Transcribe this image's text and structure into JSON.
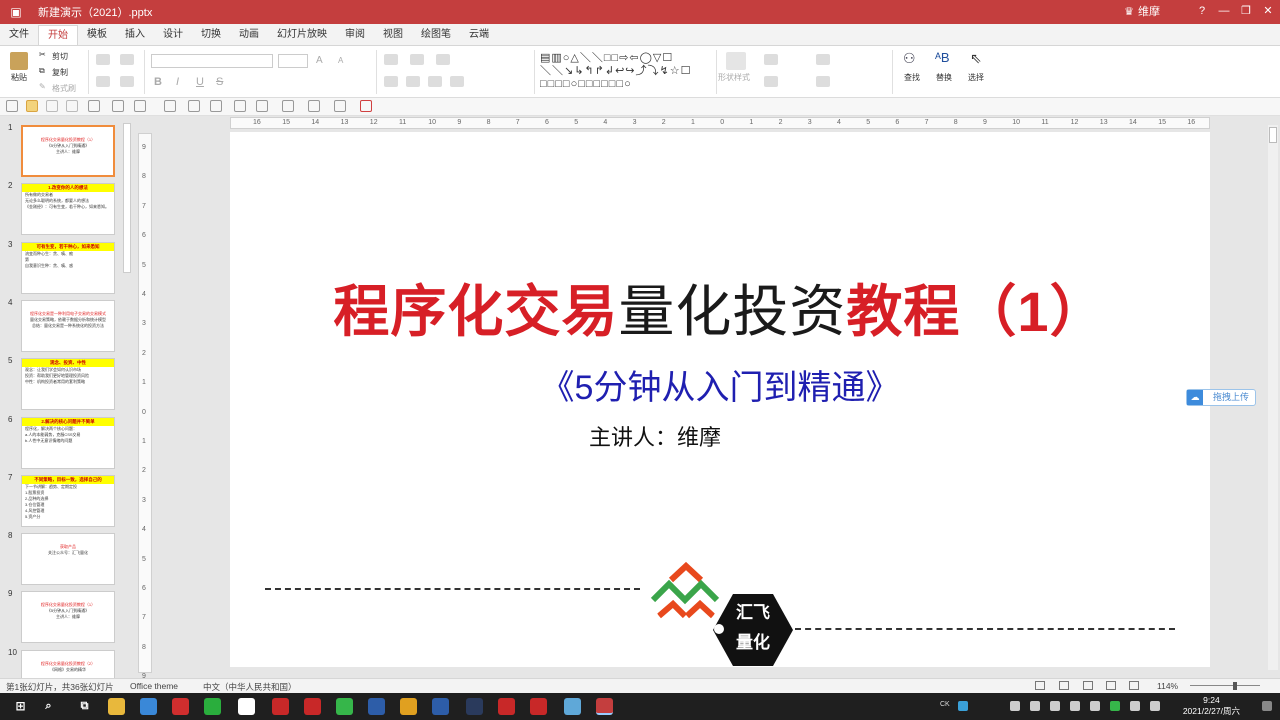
{
  "titlebar": {
    "doc_title": "新建演示（2021）.pptx",
    "user": "维摩",
    "help": "?",
    "minimize": "—",
    "restore": "❐",
    "close": "✕"
  },
  "ribbon_tabs": [
    "文件",
    "开始",
    "模板",
    "插入",
    "设计",
    "切换",
    "动画",
    "幻灯片放映",
    "审阅",
    "视图",
    "绘图笔",
    "云端"
  ],
  "active_tab": "开始",
  "ribbon": {
    "paste": "粘贴",
    "cut": "剪切",
    "copy": "复制",
    "format_painter": "格式刷",
    "shape_style": "形状样式",
    "find": "查找",
    "replace": "替换",
    "select": "选择",
    "font_bold": "B",
    "font_italic": "I",
    "font_underline": "U",
    "font_strike": "S",
    "font_size_up": "A",
    "font_size_down": "A"
  },
  "thumbnails": [
    {
      "num": "1",
      "lines": [
        "程序化交易量化投资教程（1）",
        "《5分钟从入门到精通》",
        "主讲人：维摩"
      ]
    },
    {
      "num": "2",
      "header": "1.改变你的人的想法",
      "lines": [
        "所有做的交易者",
        "无论多么聪明的系统，都要人的想法",
        "《金刚经》：可有生变，若干种心，如来悉知。"
      ]
    },
    {
      "num": "3",
      "header": "可有生变，若干种心，如来悉知",
      "lines": [
        "流变而种心生：贪、嗔、痴",
        "第",
        "自我意识生种：贪、嗔、惑"
      ]
    },
    {
      "num": "4",
      "lines": [
        "程序化交易是一种利用电子交易的交易模式",
        "量化交易策略，依赖于数据分析和统计模型",
        "总结：量化交易是一种系统化的投资方法"
      ]
    },
    {
      "num": "5",
      "header": "观念、投资、中性",
      "lines": [
        "观念：让我们学会如何认识市场",
        "投资：帮助我们更好地管理投资风险",
        "中性：机构投资者常用的套利策略"
      ]
    },
    {
      "num": "6",
      "header": "2.解决的核心问题并不简单",
      "lines": [
        "程序化，解决两个核心问题：",
        "a.人的本能弱势，克服CSS交易",
        "b.人性中无意识情绪的问题"
      ]
    },
    {
      "num": "7",
      "header": "不同策略，目标一致，选择自己的",
      "lines": [
        "下一节讲解：趋势、定期定投",
        "1.股票投资",
        "2.品种的选择",
        "3.仓位管理",
        "4.风控管理",
        "5.资产分"
      ]
    },
    {
      "num": "8",
      "lines": [
        "获取产品",
        "关注公众号：汇飞量化"
      ]
    },
    {
      "num": "9",
      "lines": [
        "程序化交易量化投资教程（1）",
        "《5分钟从入门到精通》",
        "主讲人：维摩"
      ]
    },
    {
      "num": "10",
      "lines": [
        "程序化交易量化投资教程（2）",
        "《网格》交易的精华"
      ]
    }
  ],
  "hruler_labels": [
    "16",
    "15",
    "14",
    "13",
    "12",
    "11",
    "10",
    "9",
    "8",
    "7",
    "6",
    "5",
    "4",
    "3",
    "2",
    "1",
    "0",
    "1",
    "2",
    "3",
    "4",
    "5",
    "6",
    "7",
    "8",
    "9",
    "10",
    "11",
    "12",
    "13",
    "14",
    "15",
    "16"
  ],
  "vruler_labels": [
    "9",
    "8",
    "7",
    "6",
    "5",
    "4",
    "3",
    "2",
    "1",
    "0",
    "1",
    "2",
    "3",
    "4",
    "5",
    "6",
    "7",
    "8",
    "9"
  ],
  "slide": {
    "title_red1": "程序化交易",
    "title_black": "量化投资",
    "title_red2": "教程（1）",
    "subtitle": "《5分钟从入门到精通》",
    "presenter": "主讲人：维摩",
    "logo_text1": "汇飞",
    "logo_text2": "量化"
  },
  "float_upload": "拖拽上传",
  "statusbar": {
    "slide_info": "第1张幻灯片，共36张幻灯片",
    "theme": "Office theme",
    "language": "中文（中华人民共和国）",
    "zoom": "114%"
  },
  "taskbar": {
    "time": "9:24",
    "date": "2021/2/27/周六",
    "ime": "CK"
  },
  "colors": {
    "accent": "#c43e3e",
    "title_red": "#d71f26",
    "subtitle_blue": "#1f1fb0",
    "logo_green": "#3aa54a",
    "logo_orange": "#e8491d"
  }
}
